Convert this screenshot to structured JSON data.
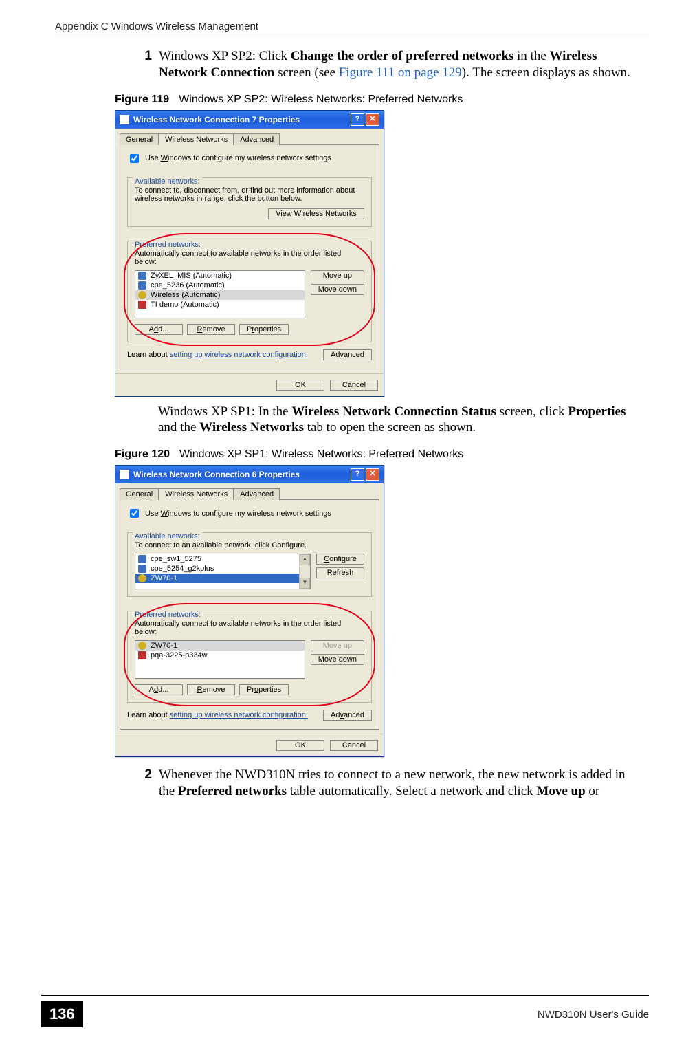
{
  "header": {
    "title": "Appendix C Windows Wireless Management"
  },
  "step1": {
    "num": "1",
    "pre": "Windows XP SP2: Click ",
    "b1": "Change the order of preferred networks",
    "mid1": " in the ",
    "b2": "Wireless Network Connection",
    "mid2": " screen (see ",
    "link": "Figure 111 on page 129",
    "tail": "). The screen displays as shown."
  },
  "fig119": {
    "num": "Figure 119",
    "cap": "Windows XP SP2: Wireless Networks: Preferred Networks"
  },
  "dlg1": {
    "title": "Wireless Network Connection 7 Properties",
    "help": "?",
    "close": "✕",
    "tabs": {
      "general": "General",
      "wireless": "Wireless Networks",
      "advanced": "Advanced"
    },
    "check_pre": "Use ",
    "check_u": "W",
    "check_post": "indows to configure my wireless network settings",
    "avail_label": "Available networks:",
    "avail_text": "To connect to, disconnect from, or find out more information about wireless networks in range, click the button below.",
    "btn_view": "View Wireless Networks",
    "pref_label": "Preferred networks:",
    "pref_text": "Automatically connect to available networks in the order listed below:",
    "nets": [
      {
        "name": "ZyXEL_MIS (Automatic)",
        "icon": "infra"
      },
      {
        "name": "cpe_5236 (Automatic)",
        "icon": "infra"
      },
      {
        "name": "Wireless (Automatic)",
        "icon": "adhoc",
        "sel": true
      },
      {
        "name": "TI demo (Automatic)",
        "icon": "x"
      }
    ],
    "btn_moveup": "Move up",
    "btn_movedown": "Move down",
    "btn_add_pre": "A",
    "btn_add_u": "d",
    "btn_add_post": "d...",
    "btn_remove_u": "R",
    "btn_remove_post": "emove",
    "btn_props_pre": "P",
    "btn_props_u": "r",
    "btn_props_post": "operties",
    "learn_pre": "Learn about ",
    "learn_link": "setting up wireless network configuration.",
    "btn_adv_pre": "Ad",
    "btn_adv_u": "v",
    "btn_adv_post": "anced",
    "btn_ok": "OK",
    "btn_cancel": "Cancel"
  },
  "para_mid": {
    "pre": "Windows XP SP1: In the ",
    "b1": "Wireless Network Connection Status",
    "mid1": " screen, click ",
    "b2": "Properties",
    "mid2": " and the ",
    "b3": "Wireless Networks",
    "tail": " tab to open the screen as shown."
  },
  "fig120": {
    "num": "Figure 120",
    "cap": "Windows XP SP1: Wireless Networks: Preferred Networks"
  },
  "dlg2": {
    "title": "Wireless Network Connection 6 Properties",
    "avail_label": "Available networks:",
    "avail_text": "To connect to an available network, click Configure.",
    "avail_nets": [
      {
        "name": "cpe_sw1_5275",
        "icon": "infra"
      },
      {
        "name": "cpe_5254_g2kplus",
        "icon": "infra"
      },
      {
        "name": "ZW70-1",
        "icon": "adhoc",
        "sel": true
      }
    ],
    "btn_configure_u": "C",
    "btn_configure_post": "onfigure",
    "btn_refresh_pre": "Refr",
    "btn_refresh_u": "e",
    "btn_refresh_post": "sh",
    "pref_label": "Preferred networks:",
    "pref_text": "Automatically connect to available networks in the order listed below:",
    "pref_nets": [
      {
        "name": "ZW70-1",
        "icon": "adhoc",
        "sel": true
      },
      {
        "name": "pqa-3225-p334w",
        "icon": "x"
      }
    ],
    "btn_moveup": "Move up",
    "btn_movedown": "Move down",
    "btn_add_pre": "A",
    "btn_add_u": "d",
    "btn_add_post": "d...",
    "btn_remove_u": "R",
    "btn_remove_post": "emove",
    "btn_props_pre": "Pr",
    "btn_props_u": "o",
    "btn_props_post": "perties",
    "learn_pre": "Learn about ",
    "learn_link": "setting up wireless network configuration.",
    "btn_adv_pre": "Ad",
    "btn_adv_u": "v",
    "btn_adv_post": "anced",
    "btn_ok": "OK",
    "btn_cancel": "Cancel"
  },
  "step2": {
    "num": "2",
    "pre": "Whenever the NWD310N tries to connect to a new network, the new network is added in the ",
    "b1": "Preferred networks",
    "mid1": " table automatically. Select a network and click ",
    "b2": "Move up",
    "tail": " or"
  },
  "footer": {
    "page": "136",
    "guide": "NWD310N User's Guide"
  }
}
